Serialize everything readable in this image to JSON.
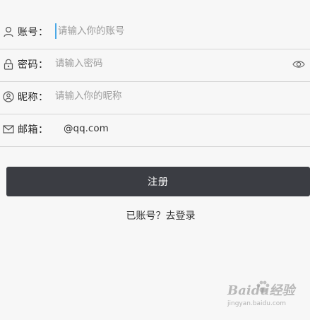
{
  "form": {
    "account": {
      "label": "账号：",
      "placeholder": "请输入你的账号",
      "value": ""
    },
    "password": {
      "label": "密码：",
      "placeholder": "请输入密码",
      "value": ""
    },
    "nickname": {
      "label": "昵称：",
      "placeholder": "请输入你的昵称",
      "value": ""
    },
    "email": {
      "label": "邮箱：",
      "placeholder": "",
      "value": "@qq.com"
    }
  },
  "register_button": "注册",
  "login_link": "已账号？去登录",
  "watermark": {
    "name": "Baidu经验",
    "url": "jingyan.baidu.com"
  },
  "icons": {
    "account": "user-icon",
    "password": "lock-icon",
    "nickname": "face-icon",
    "email": "mail-icon",
    "toggle": "eye-icon"
  },
  "colors": {
    "button_bg": "#3b3d43",
    "cursor": "#4aa8e6",
    "divider": "#d6d6d6"
  }
}
